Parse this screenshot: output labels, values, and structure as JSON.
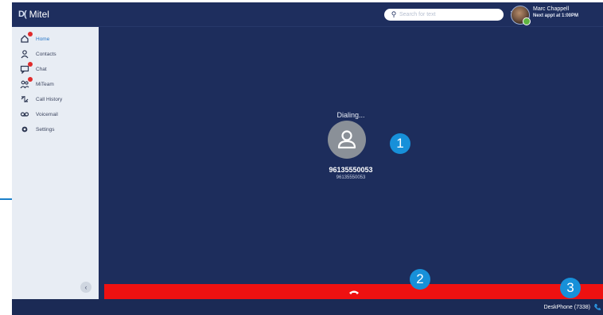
{
  "app": {
    "title": "Mitel"
  },
  "search": {
    "placeholder": "Search for text"
  },
  "user": {
    "name": "Marc Chappell",
    "next": "Next appt at 1:00PM"
  },
  "sidebar": {
    "items": [
      {
        "label": "Home",
        "icon": "home-icon",
        "active": true,
        "badge": true
      },
      {
        "label": "Contacts",
        "icon": "contacts-icon",
        "active": false,
        "badge": false
      },
      {
        "label": "Chat",
        "icon": "chat-icon",
        "active": false,
        "badge": true
      },
      {
        "label": "MiTeam",
        "icon": "miteam-icon",
        "active": false,
        "badge": true
      },
      {
        "label": "Call History",
        "icon": "call-history-icon",
        "active": false,
        "badge": false
      },
      {
        "label": "Voicemail",
        "icon": "voicemail-icon",
        "active": false,
        "badge": false
      },
      {
        "label": "Settings",
        "icon": "settings-icon",
        "active": false,
        "badge": false
      }
    ],
    "collapse_glyph": "‹"
  },
  "call": {
    "status": "Dialing...",
    "number": "96135550053",
    "sub_number": "96135550053"
  },
  "status_bar": {
    "device": "DeskPhone (7338)"
  },
  "callouts": [
    "1",
    "2",
    "3"
  ],
  "colors": {
    "background": "#1d2d5c",
    "hangup": "#ee1111",
    "accent": "#1790d9",
    "sidebar": "#e8edf4"
  }
}
